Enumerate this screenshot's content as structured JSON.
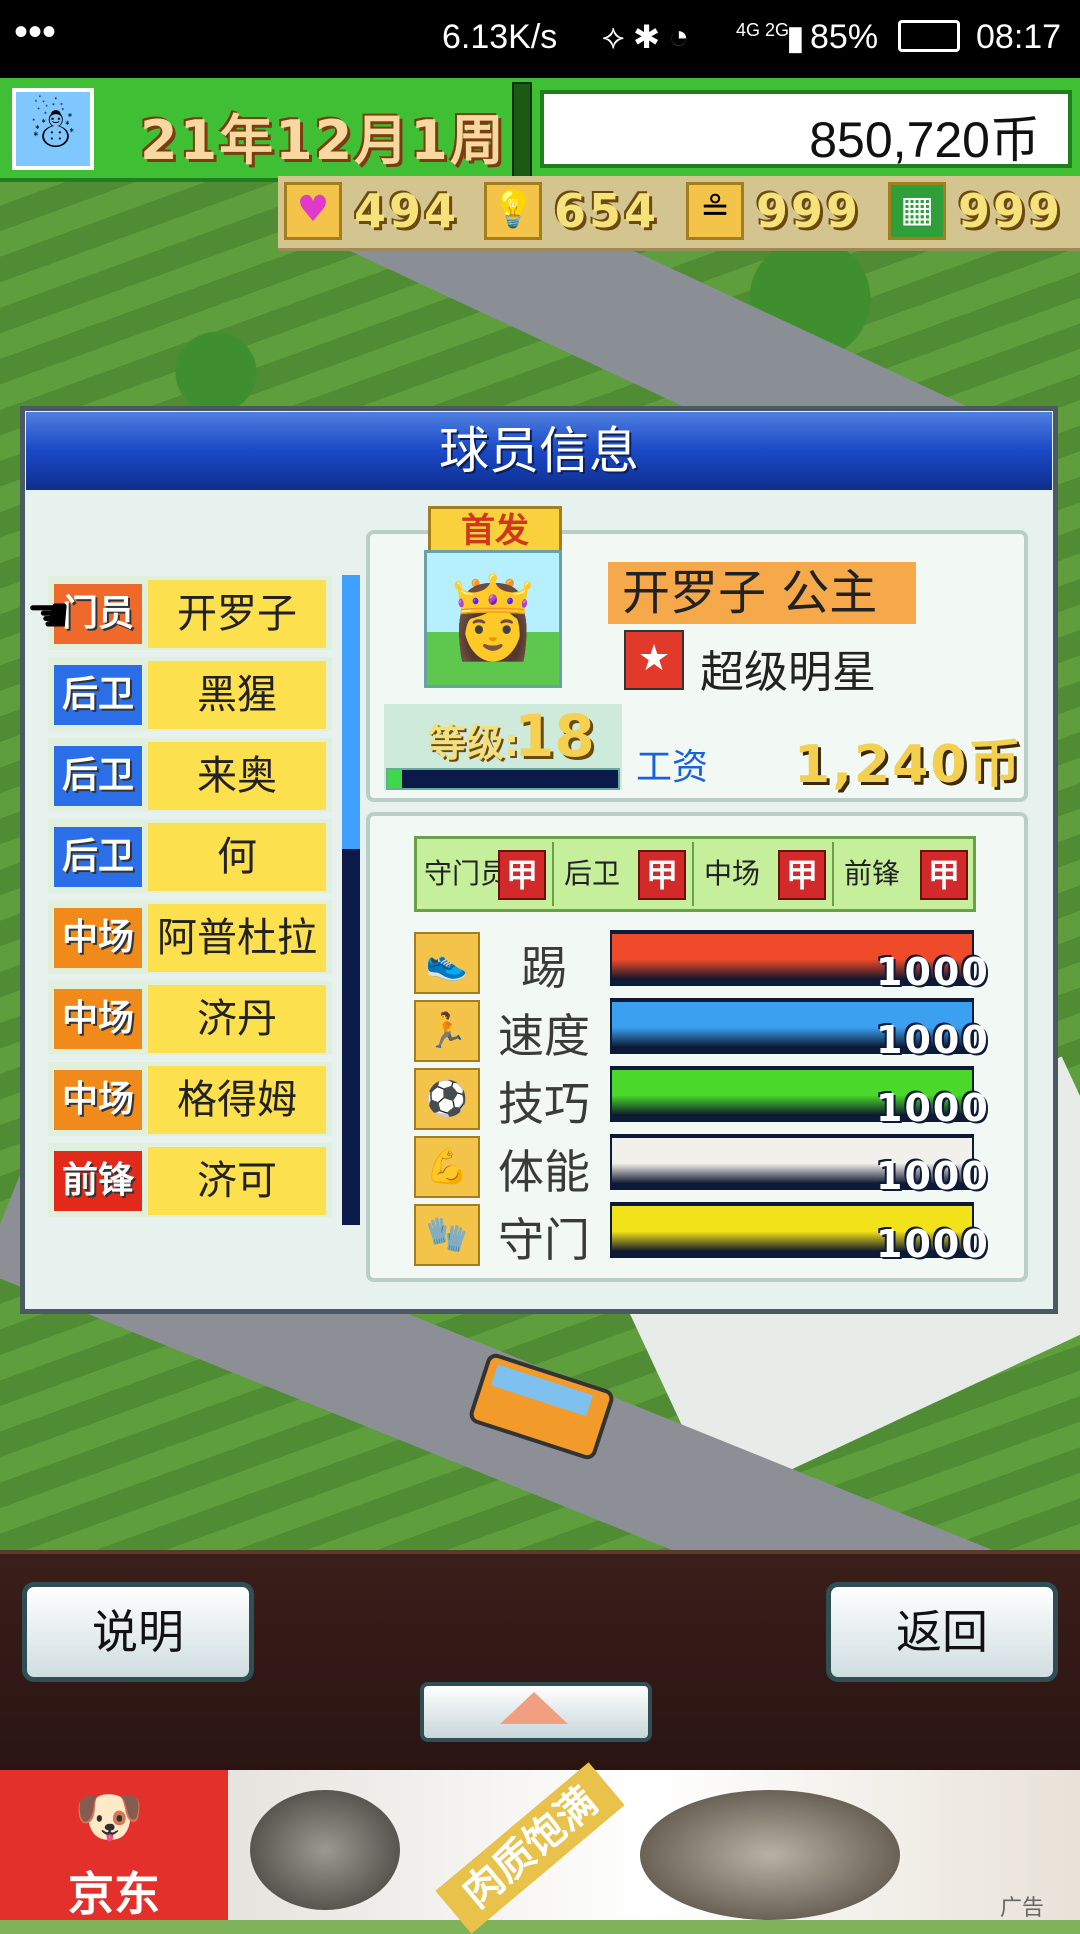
{
  "status_bar": {
    "speed": "6.13K/s",
    "network": "4G 2G",
    "battery": "85%",
    "time": "08:17"
  },
  "hud": {
    "date": "21年12月1周",
    "money": "850,720币",
    "resources": [
      {
        "icon": "heart-icon",
        "symbol": "♥",
        "value": "494"
      },
      {
        "icon": "lightbulb-icon",
        "symbol": "💡",
        "value": "654"
      },
      {
        "icon": "money-bag-icon",
        "symbol": "≗",
        "value": "999"
      },
      {
        "icon": "field-icon",
        "symbol": "▦",
        "value": "999"
      }
    ]
  },
  "dialog": {
    "title": "球员信息",
    "players": [
      {
        "position": "门员",
        "name": "开罗子",
        "color": "#ef6a2a"
      },
      {
        "position": "后卫",
        "name": "黑猩",
        "color": "#2a6ee8"
      },
      {
        "position": "后卫",
        "name": "来奥",
        "color": "#2a6ee8"
      },
      {
        "position": "后卫",
        "name": "何",
        "color": "#2a6ee8"
      },
      {
        "position": "中场",
        "name": "阿普杜拉",
        "color": "#f08a1a"
      },
      {
        "position": "中场",
        "name": "济丹",
        "color": "#f08a1a"
      },
      {
        "position": "中场",
        "name": "格得姆",
        "color": "#f08a1a"
      },
      {
        "position": "前锋",
        "name": "济可",
        "color": "#e12a1a"
      }
    ],
    "player": {
      "starter_badge": "首发",
      "name": "开罗子 公主",
      "title": "超级明星",
      "level_label": "等级:",
      "level": "18",
      "exp_progress": 0.06,
      "salary_label": "工资",
      "salary": "1,240币"
    },
    "aptitudes": [
      {
        "position": "守门员",
        "grade": "甲"
      },
      {
        "position": "后卫",
        "grade": "甲"
      },
      {
        "position": "中场",
        "grade": "甲"
      },
      {
        "position": "前锋",
        "grade": "甲"
      }
    ],
    "stats": [
      {
        "label": "踢",
        "value": "1000",
        "level": 1.0,
        "color": "#ef4a2a",
        "icon": "kick-icon",
        "symbol": "👟"
      },
      {
        "label": "速度",
        "value": "1000",
        "level": 1.0,
        "color": "#3aa0ef",
        "icon": "speed-icon",
        "symbol": "🏃"
      },
      {
        "label": "技巧",
        "value": "1000",
        "level": 1.0,
        "color": "#4ad82a",
        "icon": "technique-icon",
        "symbol": "⚽"
      },
      {
        "label": "体能",
        "value": "1000",
        "level": 1.0,
        "color": "#f2f0ea",
        "icon": "stamina-icon",
        "symbol": "💪"
      },
      {
        "label": "守门",
        "value": "1000",
        "level": 1.0,
        "color": "#f2e21a",
        "icon": "keeper-icon",
        "symbol": "🧤"
      }
    ]
  },
  "buttons": {
    "help": "说明",
    "back": "返回"
  },
  "ad": {
    "brand": "京东",
    "ribbon": "肉质饱满",
    "tag": "广告"
  }
}
